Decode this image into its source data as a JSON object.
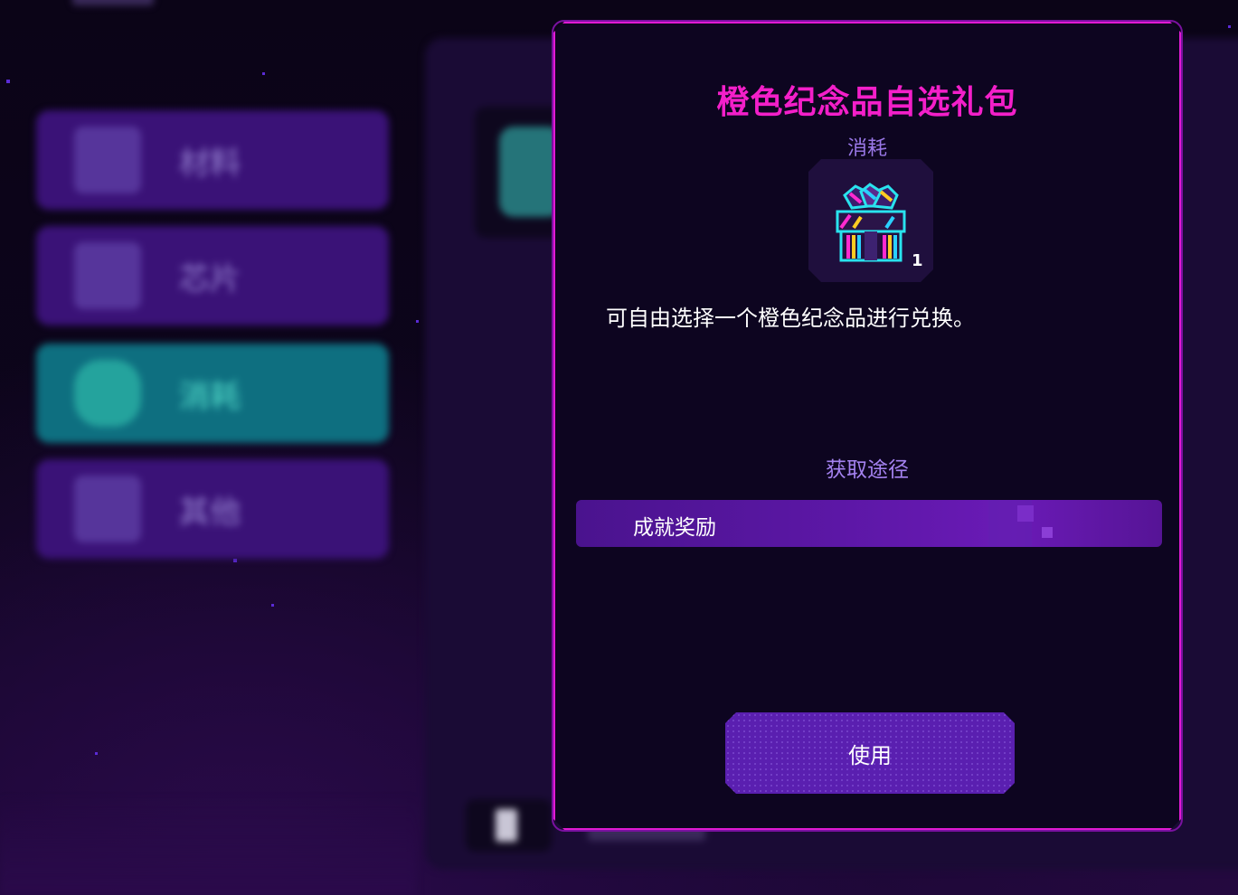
{
  "colors": {
    "modal_border": "#e01ad4",
    "title": "#f31fc9",
    "accent_purple": "#5a1fb0",
    "active_category": "#0e6f80"
  },
  "sidebar": {
    "categories": [
      {
        "label": "材料",
        "icon": "materials-icon",
        "active": false
      },
      {
        "label": "芯片",
        "icon": "chip-icon",
        "active": false
      },
      {
        "label": "消耗",
        "icon": "consumable-icon",
        "active": true
      },
      {
        "label": "其他",
        "icon": "other-box-icon",
        "active": false
      }
    ]
  },
  "modal": {
    "title": "橙色纪念品自选礼包",
    "type_label": "消耗",
    "item_icon": "gift-box-icon",
    "item_count": "1",
    "description": "可自由选择一个橙色纪念品进行兑换。",
    "source_heading": "获取途径",
    "sources": [
      "成就奖励"
    ],
    "use_button": "使用"
  }
}
